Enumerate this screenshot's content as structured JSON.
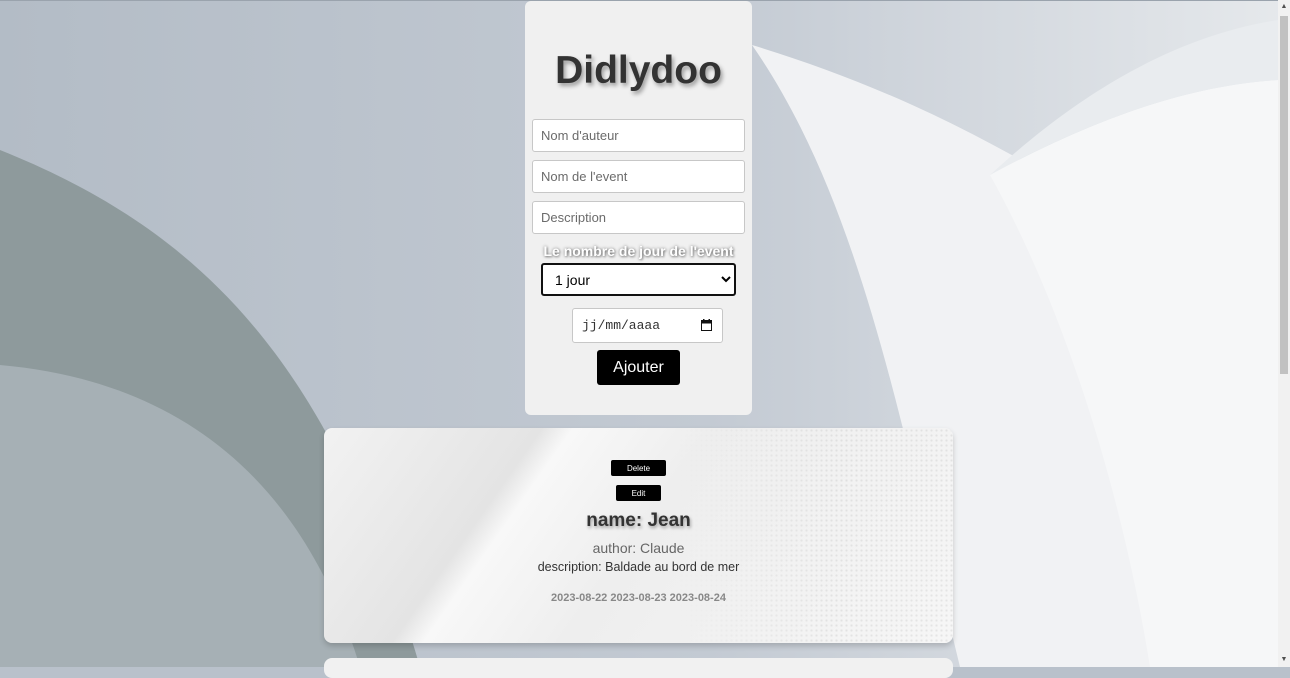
{
  "app": {
    "title": "Didlydoo"
  },
  "form": {
    "author_placeholder": "Nom d'auteur",
    "event_placeholder": "Nom de l'event",
    "description_placeholder": "Description",
    "days_label": "Le nombre de jour de l'event",
    "days_options": [
      "1 jour"
    ],
    "days_selected": "1 jour",
    "date_placeholder": "jj/mm/aaaa",
    "submit_label": "Ajouter"
  },
  "events": [
    {
      "delete_label": "Delete",
      "edit_label": "Edit",
      "name": "name: Jean",
      "author": "author: Claude",
      "description": "description: Baldade au bord de mer",
      "dates": "2023-08-22 2023-08-23 2023-08-24"
    }
  ],
  "icons": {
    "calendar": "calendar-icon",
    "scroll_up": "scroll-up-arrow-icon",
    "scroll_down": "scroll-down-arrow-icon"
  },
  "colors": {
    "background": "#b9c1cb",
    "card": "#f0f0f0",
    "button": "#000000",
    "title_text": "#333333"
  }
}
